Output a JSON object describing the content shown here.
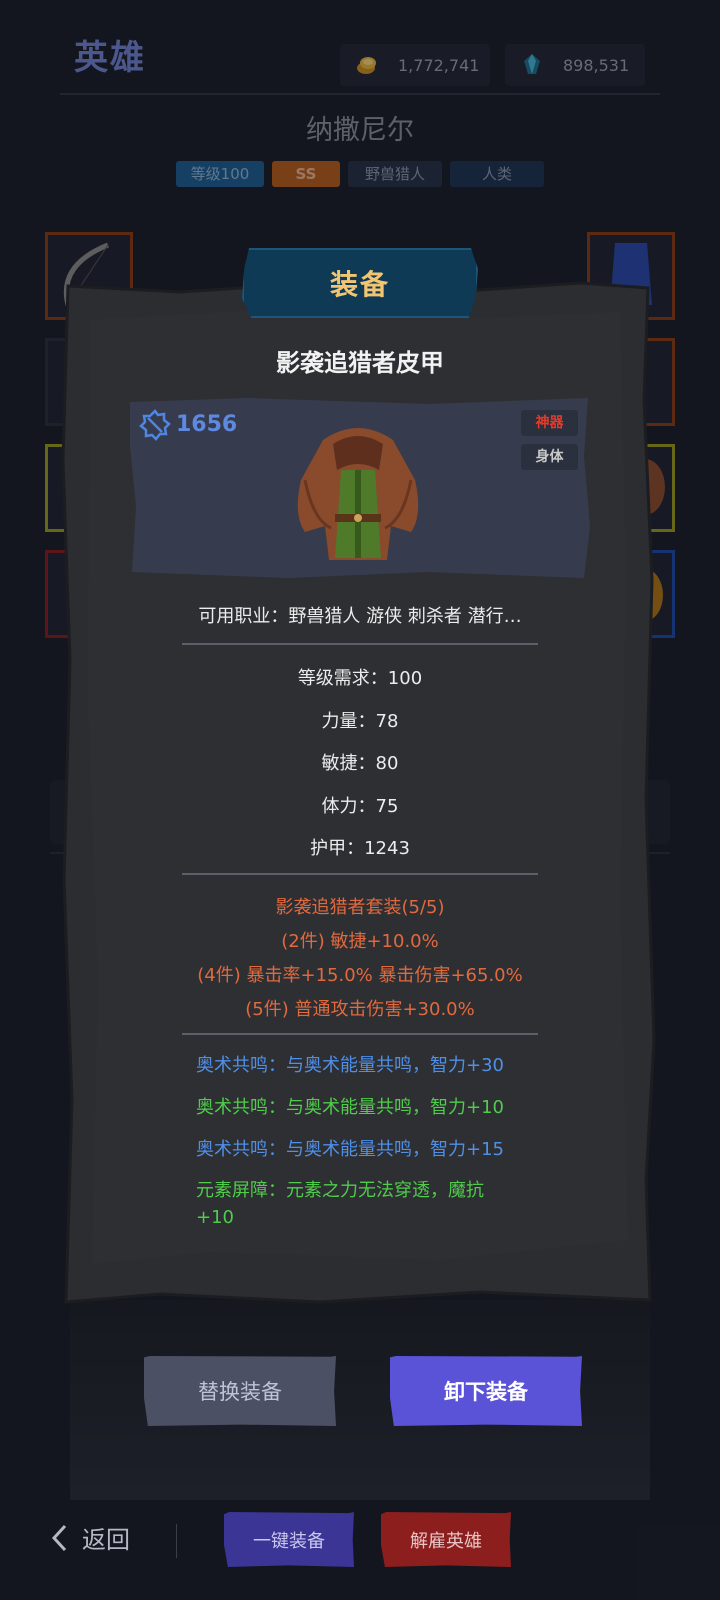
{
  "header": {
    "title": "英雄",
    "gold": "1,772,741",
    "gems": "898,531",
    "gold_icon": "gold-coins-icon",
    "gem_icon": "crystal-icon"
  },
  "hero": {
    "name": "纳撒尼尔",
    "tags": [
      "等级100",
      "SS",
      "野兽猎人",
      "人类"
    ]
  },
  "modal": {
    "title": "装备",
    "item_name": "影袭追猎者皮甲",
    "power": "1656",
    "quality": "神器",
    "slot": "身体",
    "classes": "可用职业：野兽猎人 游侠 刺杀者 潜行…",
    "stats": [
      "等级需求：100",
      "力量：78",
      "敏捷：80",
      "体力：75",
      "护甲：1243"
    ],
    "set": {
      "title": "影袭追猎者套装(5/5)",
      "bonuses": [
        "(2件) 敏捷+10.0%",
        "(4件) 暴击率+15.0%   暴击伤害+65.0%",
        "(5件) 普通攻击伤害+30.0%"
      ]
    },
    "affixes": [
      {
        "text": "奥术共鸣：与奥术能量共鸣，智力+30",
        "color": "#4f8fe8"
      },
      {
        "text": "奥术共鸣：与奥术能量共鸣，智力+10",
        "color": "#4fcc4a"
      },
      {
        "text": "奥术共鸣：与奥术能量共鸣，智力+15",
        "color": "#4f8fe8"
      },
      {
        "text": "元素屏障：元素之力无法穿透，魔抗+10",
        "color": "#4fcc4a"
      }
    ],
    "buttons": {
      "replace": "替换装备",
      "remove": "卸下装备"
    }
  },
  "bottom": {
    "back": "返回",
    "equip_all": "一键装备",
    "dismiss": "解雇英雄"
  }
}
